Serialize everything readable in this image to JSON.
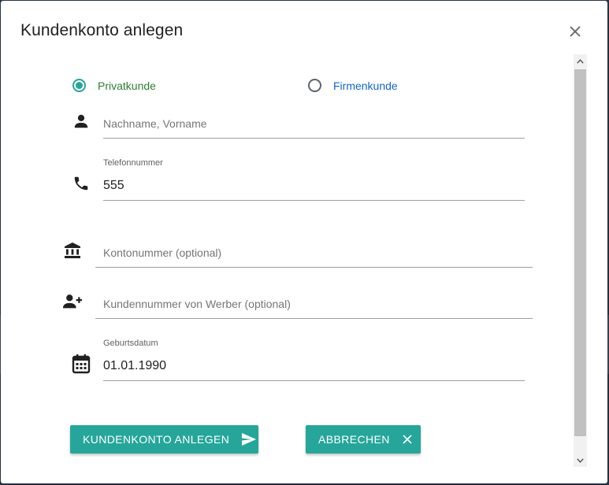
{
  "dialog": {
    "title": "Kundenkonto anlegen"
  },
  "customer_type": {
    "options": [
      {
        "label": "Privatkunde",
        "checked": true
      },
      {
        "label": "Firmenkunde",
        "checked": false
      }
    ]
  },
  "form": {
    "name": {
      "placeholder": "Nachname, Vorname",
      "value": ""
    },
    "phone": {
      "label": "Telefonnummer",
      "value": "555"
    },
    "account": {
      "placeholder": "Kontonummer (optional)",
      "value": ""
    },
    "referrer": {
      "placeholder": "Kundennummer von Werber (optional)",
      "value": ""
    },
    "birthdate": {
      "label": "Geburtsdatum",
      "value": "01.01.1990"
    }
  },
  "actions": {
    "create_label": "KUNDENKONTO ANLEGEN",
    "cancel_label": "ABBRECHEN"
  },
  "colors": {
    "accent": "#26a69a",
    "private_label": "#2e7d32",
    "company_label": "#1565c0"
  },
  "icons": {
    "close": "close-icon",
    "name": "person-icon",
    "phone": "phone-icon",
    "account": "bank-icon",
    "referrer": "person-add-icon",
    "birthdate": "calendar-icon",
    "send": "send-icon",
    "cancel": "close-icon"
  }
}
